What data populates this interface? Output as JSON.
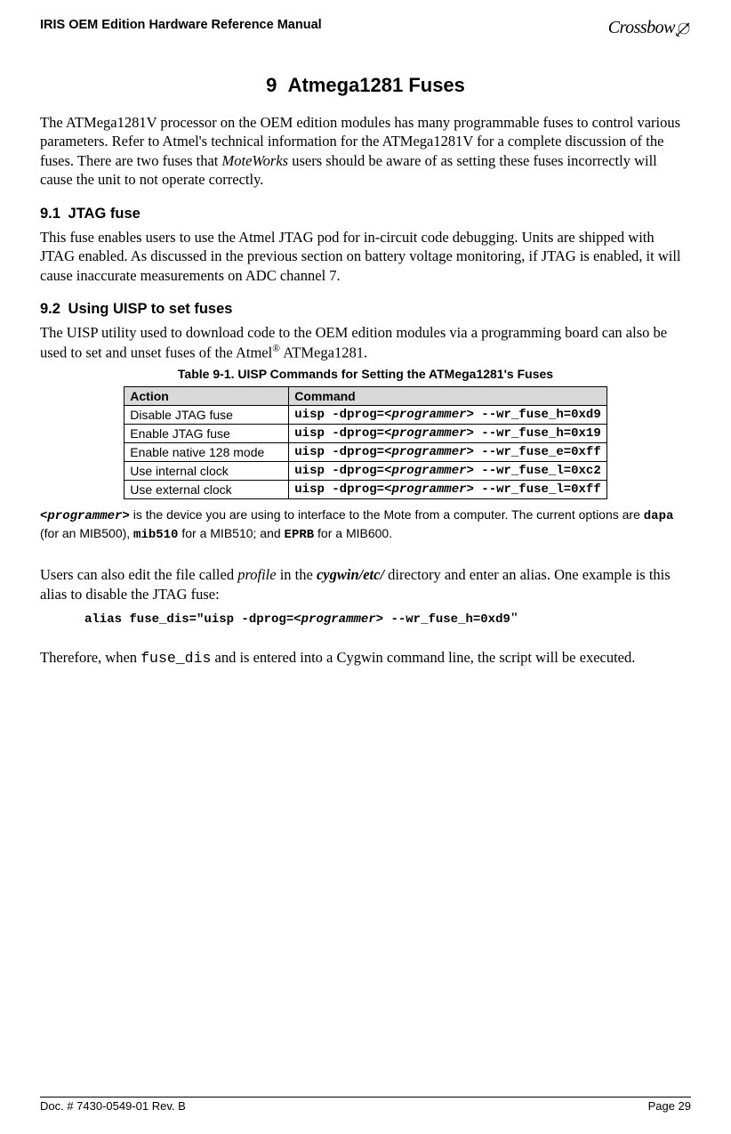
{
  "header": {
    "title": "IRIS OEM Edition Hardware Reference Manual",
    "logo": "Crossbow"
  },
  "chapter": {
    "number": "9",
    "title": "Atmega1281 Fuses"
  },
  "intro_text": "The ATMega1281V processor on the OEM edition modules has many programmable fuses to control various parameters. Refer to Atmel's technical information for the ATMega1281V for a complete discussion of the fuses. There are two fuses that ",
  "intro_italic": "MoteWorks",
  "intro_text2": " users should be aware of as setting these fuses incorrectly will cause the unit to not operate correctly.",
  "section91": {
    "num": "9.1",
    "title": "JTAG fuse",
    "text": "This fuse enables users to use the Atmel JTAG pod for in-circuit code debugging. Units are shipped with JTAG enabled. As discussed in the previous section on battery voltage monitoring, if JTAG is enabled, it will cause inaccurate measurements on ADC channel 7."
  },
  "section92": {
    "num": "9.2",
    "title": "Using UISP to set fuses",
    "text1": "The UISP utility used to download code to the OEM edition modules via a programming board can also be used to set and unset fuses of the Atmel",
    "sup": "®",
    "text2": " ATMega1281."
  },
  "table": {
    "caption": "Table 9-1. UISP Commands for Setting the ATMega1281's Fuses",
    "headers": {
      "action": "Action",
      "command": "Command"
    },
    "rows": [
      {
        "action": "Disable JTAG fuse",
        "cmd_pre": "uisp -dprog=<",
        "cmd_prog": "programmer",
        "cmd_post": "> --wr_fuse_h=0xd9"
      },
      {
        "action": "Enable JTAG fuse",
        "cmd_pre": "uisp -dprog=<",
        "cmd_prog": "programmer",
        "cmd_post": "> --wr_fuse_h=0x19"
      },
      {
        "action": "Enable native 128 mode",
        "cmd_pre": "uisp -dprog=<",
        "cmd_prog": "programmer",
        "cmd_post": "> --wr_fuse_e=0xff"
      },
      {
        "action": "Use internal clock",
        "cmd_pre": "uisp -dprog=<",
        "cmd_prog": "programmer",
        "cmd_post": "> --wr_fuse_l=0xc2"
      },
      {
        "action": "Use external clock",
        "cmd_pre": "uisp -dprog=<",
        "cmd_prog": "programmer",
        "cmd_post": "> --wr_fuse_l=0xff"
      }
    ]
  },
  "note": {
    "prog_tag": "<programmer>",
    "text1": " is the device you are using to interface to the Mote from a computer. The current options are ",
    "dapa": "dapa",
    "text2": " (for an MIB500), ",
    "mib510": "mib510",
    "text3": " for a MIB510; and ",
    "eprb": "EPRB",
    "text4": " for a MIB600."
  },
  "profile_para": {
    "text1": "Users can also edit the file called ",
    "profile": "profile",
    "text2": " in the ",
    "cygwin": "cygwin/etc/",
    "text3": " directory and enter an alias. One example is this alias to disable the JTAG fuse:"
  },
  "alias": {
    "pre": "alias fuse_dis=\"uisp -dprog=<",
    "prog": "programmer",
    "post": "> --wr_fuse_h=0xd9",
    "quote": "\""
  },
  "therefore": {
    "text1": "Therefore, when ",
    "fuse_dis": "fuse_dis",
    "text2": " and is entered into a Cygwin command line, the script will be executed."
  },
  "footer": {
    "left": "Doc. # 7430-0549-01 Rev. B",
    "right": "Page 29"
  }
}
